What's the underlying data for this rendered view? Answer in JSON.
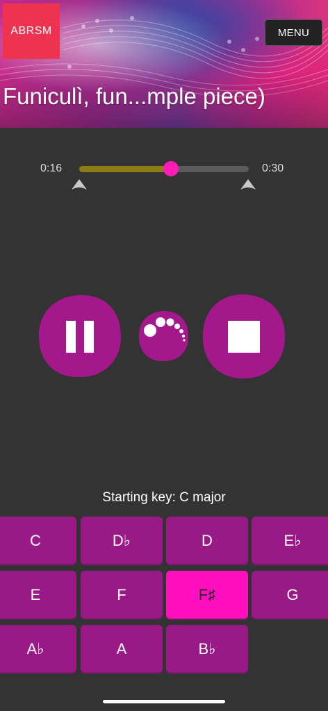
{
  "header": {
    "logo_text": "ABRSM",
    "menu_label": "MENU",
    "title": "Funiculì, fun...mple piece)"
  },
  "player": {
    "time_start": "0:16",
    "time_end": "0:30",
    "progress_fraction": 0.54,
    "accent_color": "#ff1bb5",
    "button_color": "#a3188a",
    "controls": {
      "pause_icon": "pause-icon",
      "loading_icon": "loading-dots-icon",
      "stop_icon": "stop-icon"
    }
  },
  "keys": {
    "starting_key_label": "Starting key: C major",
    "selected": "F♯",
    "items": [
      {
        "label": "C"
      },
      {
        "label": "D♭"
      },
      {
        "label": "D"
      },
      {
        "label": "E♭"
      },
      {
        "label": "E"
      },
      {
        "label": "F"
      },
      {
        "label": "F♯"
      },
      {
        "label": "G"
      },
      {
        "label": "A♭"
      },
      {
        "label": "A"
      },
      {
        "label": "B♭"
      }
    ]
  }
}
